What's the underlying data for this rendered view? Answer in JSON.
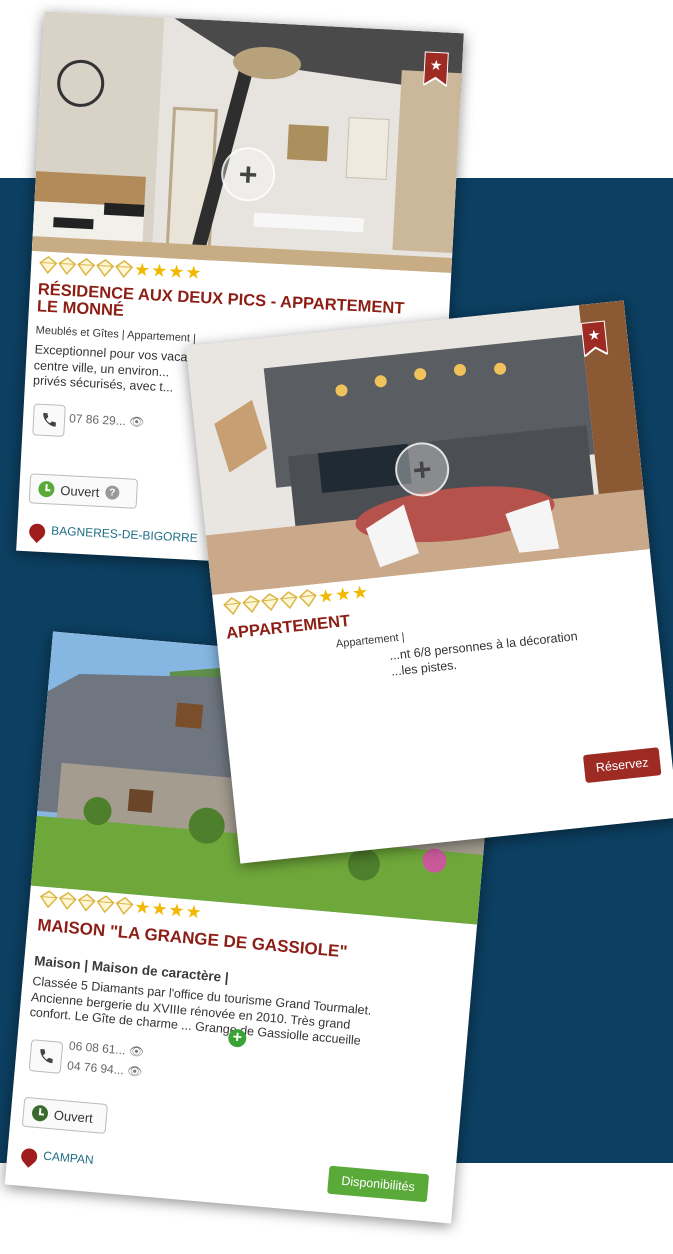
{
  "colors": {
    "background_band": "#0c3f61",
    "title": "#8c1e15",
    "location": "#1e6e86",
    "reserve_button": "#9d2b24",
    "availability_button": "#5aaa3a",
    "open_clock": "#5aaa3a",
    "star": "#f2b800",
    "diamond": "#d9b645"
  },
  "cards": [
    {
      "title_line1": "RÉSIDENCE AUX DEUX PICS - APPARTEMENT",
      "title_line2": "LE MONNÉ",
      "category": "Meublés et Gîtes | Appartement |",
      "desc_line1": "Exceptionnel pour vos vacances...",
      "desc_line2": "centre ville, un environ...",
      "desc_line3": "privés sécurisés, avec t...",
      "phone": "07 86 29...",
      "open_label": "Ouvert",
      "location": "BAGNERES-DE-BIGORRE",
      "rating": {
        "diamonds": 5,
        "stars": 4
      },
      "icons": [
        "zoom-plus-icon",
        "bookmark-star-icon",
        "phone-icon",
        "eye-icon",
        "clock-icon",
        "help-icon",
        "map-pin-icon"
      ]
    },
    {
      "title": "APPARTEMENT",
      "category": "Appartement |",
      "desc_line1": "...nt 6/8 personnes à la décoration",
      "desc_line2": "...les pistes.",
      "button": "Réservez",
      "rating": {
        "diamonds": 5,
        "stars": 3
      },
      "icons": [
        "zoom-plus-icon",
        "bookmark-star-icon"
      ]
    },
    {
      "title": "MAISON \"LA GRANGE DE GASSIOLE\"",
      "category": "Maison | Maison de caractère |",
      "desc_line1": "Classée 5 Diamants par l'office du tourisme Grand Tourmalet.",
      "desc_line2": "Ancienne bergerie du XVIIIe rénovée en 2010. Très grand",
      "desc_line3": "confort. Le Gîte de charme ... Grange de Gassiolle accueille",
      "phone1": "06 08 61...",
      "phone2": "04 76 94...",
      "open_label": "Ouvert",
      "location": "CAMPAN",
      "button": "Disponibilités",
      "rating": {
        "diamonds": 5,
        "stars": 4
      },
      "icons": [
        "zoom-plus-icon",
        "bookmark-star-icon",
        "phone-icon",
        "eye-icon",
        "clock-icon",
        "map-pin-icon",
        "plus-icon"
      ]
    }
  ]
}
